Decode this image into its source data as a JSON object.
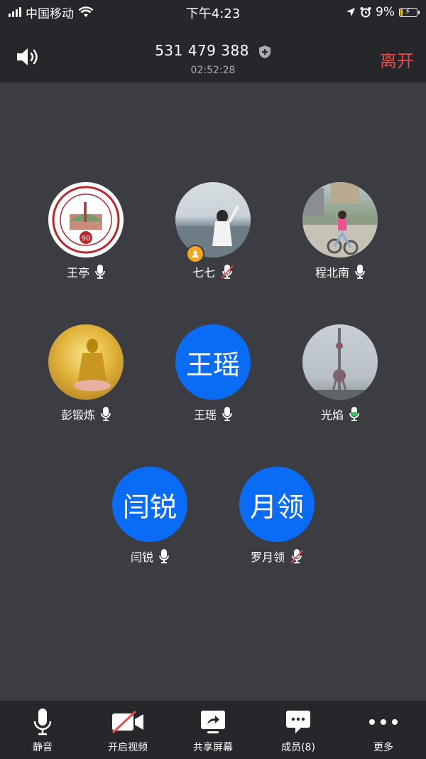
{
  "status_bar": {
    "carrier": "中国移动",
    "time": "下午4:23",
    "battery": "9%"
  },
  "header": {
    "meeting_id": "531 479 388",
    "duration": "02:52:28",
    "leave_label": "离开"
  },
  "participants": [
    {
      "name": "王亭",
      "avatar": "photo",
      "mic": "on"
    },
    {
      "name": "七七",
      "avatar": "photo",
      "mic": "muted",
      "host": true
    },
    {
      "name": "程北南",
      "avatar": "photo",
      "mic": "on"
    },
    {
      "name": "彭锻炼",
      "avatar": "photo",
      "mic": "on"
    },
    {
      "name": "王瑶",
      "avatar_text": "王瑶",
      "mic": "on"
    },
    {
      "name": "光焰",
      "avatar": "photo",
      "mic": "speaking"
    },
    {
      "name": "闫锐",
      "avatar_text": "闫锐",
      "mic": "on"
    },
    {
      "name": "罗月领",
      "avatar_text": "月领",
      "mic": "muted"
    }
  ],
  "toolbar": {
    "mute_label": "静音",
    "video_label": "开启视频",
    "share_label": "共享屏幕",
    "members_label": "成员(8)",
    "more_label": "更多"
  },
  "colors": {
    "accent_blue": "#0a6cf5",
    "leave_red": "#e94b4b",
    "speaking_green": "#34c759",
    "background": "#3b3d42",
    "bar": "#25272b"
  }
}
